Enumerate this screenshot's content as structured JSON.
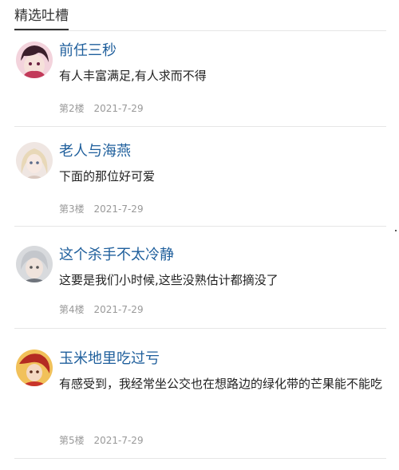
{
  "section": {
    "title": "精选吐槽"
  },
  "comments": [
    {
      "username": "前任三秒",
      "content": "有人丰富满足,有人求而不得",
      "floor": "第2楼",
      "date": "2021-7-29"
    },
    {
      "username": "老人与海燕",
      "content": "下面的那位好可爱",
      "floor": "第3楼",
      "date": "2021-7-29"
    },
    {
      "username": "这个杀手不太冷静",
      "content": "这要是我们小时候,这些没熟估计都摘没了",
      "floor": "第4楼",
      "date": "2021-7-29"
    },
    {
      "username": "玉米地里吃过亏",
      "content": "有感受到，我经常坐公交也在想路边的绿化带的芒果能不能吃",
      "floor": "第5楼",
      "date": "2021-7-29"
    }
  ]
}
